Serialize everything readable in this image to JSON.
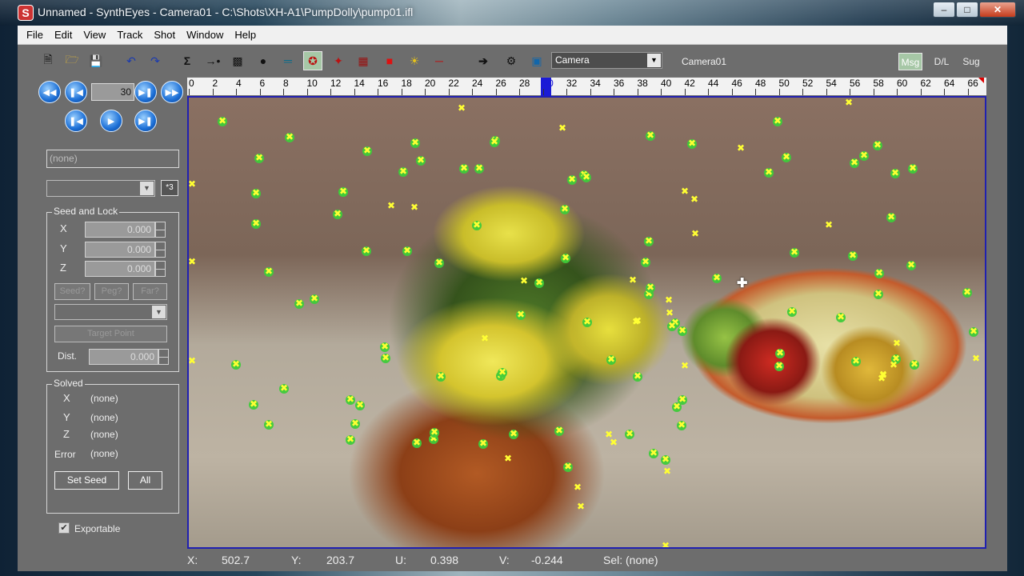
{
  "window": {
    "title": "Unnamed - SynthEyes - Camera01 - C:\\Shots\\XH-A1\\PumpDolly\\pump01.ifl",
    "icon_letter": "S",
    "buttons": [
      "minimize-icon",
      "maximize-icon",
      "close-icon"
    ]
  },
  "menu": [
    "File",
    "Edit",
    "View",
    "Track",
    "Shot",
    "Window",
    "Help"
  ],
  "toolbar": {
    "icons": [
      "new-file-icon",
      "open-folder-icon",
      "save-icon",
      "undo-icon",
      "redo-icon",
      "sigma-icon",
      "link-icon",
      "person-icon",
      "figure-icon",
      "horizontal-bars-icon",
      "tracker-icon",
      "pin-icon",
      "calculator-icon",
      "cube-icon",
      "light-icon",
      "horizon-icon",
      "arrow-right-icon",
      "gear-icon",
      "fit-icon"
    ],
    "camera_select": "Camera",
    "camera_label": "Camera01",
    "modes": [
      "Msg",
      "D/L",
      "Sug"
    ],
    "active_mode": "Msg"
  },
  "transport": {
    "frame": "30",
    "icons": [
      "rewind-icon",
      "prev-frame-icon",
      "next-frame-icon",
      "fast-forward-icon",
      "prev-key-icon",
      "play-icon",
      "next-key-icon"
    ]
  },
  "tracker_panel": {
    "name_placeholder": "(none)",
    "small_button": "*3",
    "seed_group_title": "Seed and Lock",
    "x_label": "X",
    "y_label": "Y",
    "z_label": "Z",
    "x_value": "0.000",
    "y_value": "0.000",
    "z_value": "0.000",
    "seed_btn": "Seed?",
    "peg_btn": "Peg?",
    "far_btn": "Far?",
    "target_point_btn": "Target Point",
    "dist_label": "Dist.",
    "dist_value": "0.000",
    "solved_group_title": "Solved",
    "solved_x": "(none)",
    "solved_y": "(none)",
    "solved_z": "(none)",
    "error_label": "Error",
    "error_value": "(none)",
    "set_seed_btn": "Set Seed",
    "all_btn": "All",
    "exportable_label": "Exportable",
    "exportable_checked": true
  },
  "timeline": {
    "ticks": [
      "0",
      "2",
      "4",
      "6",
      "8",
      "10",
      "12",
      "14",
      "16",
      "18",
      "20",
      "22",
      "24",
      "26",
      "28",
      "30",
      "32",
      "34",
      "36",
      "38",
      "40",
      "42",
      "44",
      "46",
      "48",
      "50",
      "52",
      "54",
      "56",
      "58",
      "60",
      "62",
      "64",
      "66"
    ],
    "current_frame": 30
  },
  "status": {
    "x_label": "X:",
    "x_value": "502.7",
    "y_label": "Y:",
    "y_value": "203.7",
    "u_label": "U:",
    "u_value": "0.398",
    "v_label": "V:",
    "v_value": "-0.244",
    "sel_label": "Sel: (none)"
  },
  "colors": {
    "tracker_yellow": "#ffff33",
    "tracker_green": "#3ecb3a",
    "viewport_border": "#2020b0",
    "active_toggle": "#a6c7a6",
    "panel_bg": "#6d6d6d"
  }
}
